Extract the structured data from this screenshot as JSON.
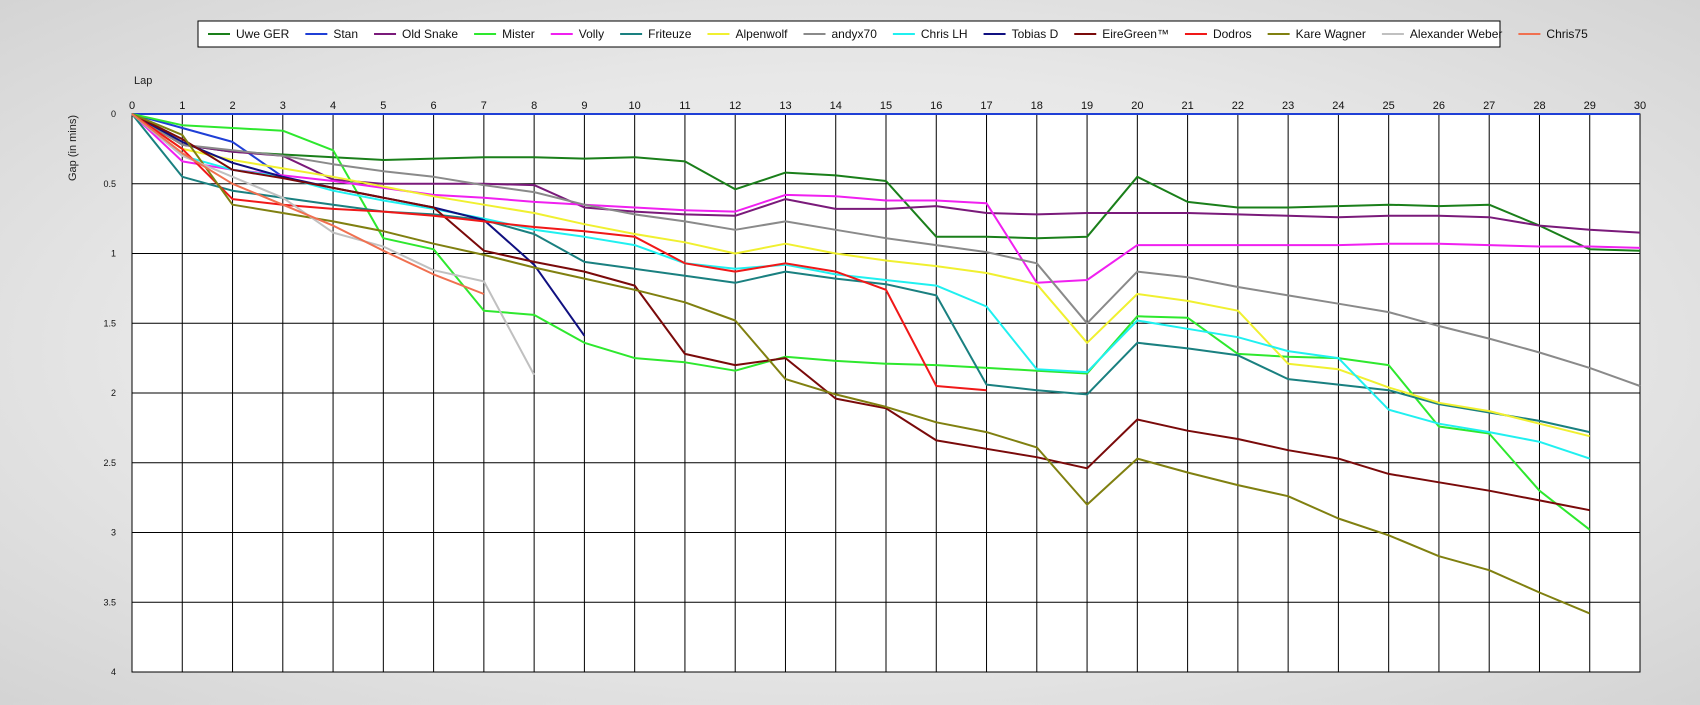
{
  "chart_data": {
    "type": "line",
    "xlabel": "Lap",
    "ylabel": "Gap (in mins)",
    "xlim": [
      0,
      30
    ],
    "ylim": [
      0,
      4
    ],
    "y_inverted": true,
    "grid": true,
    "legend_position": "top",
    "x_ticks": [
      "0",
      "1",
      "2",
      "3",
      "4",
      "5",
      "6",
      "7",
      "8",
      "9",
      "10",
      "11",
      "12",
      "13",
      "14",
      "15",
      "16",
      "17",
      "18",
      "19",
      "20",
      "21",
      "22",
      "23",
      "24",
      "25",
      "26",
      "27",
      "28",
      "29",
      "30"
    ],
    "y_ticks": [
      "0",
      "0.5",
      "1",
      "1.5",
      "2",
      "2.5",
      "3",
      "3.5",
      "4"
    ],
    "series": [
      {
        "name": "Uwe GER",
        "color": "#1a7f1a",
        "x": [
          0,
          1,
          2,
          3,
          4,
          5,
          6,
          7,
          8,
          9,
          10,
          11,
          12,
          13,
          14,
          15,
          16,
          17,
          18,
          19,
          20,
          21,
          22,
          23,
          24,
          25,
          26,
          27,
          28,
          29,
          30
        ],
        "values": [
          0,
          0.22,
          0.27,
          0.29,
          0.31,
          0.33,
          0.32,
          0.31,
          0.31,
          0.32,
          0.31,
          0.34,
          0.54,
          0.42,
          0.44,
          0.48,
          0.88,
          0.88,
          0.89,
          0.88,
          0.45,
          0.63,
          0.67,
          0.67,
          0.66,
          0.65,
          0.66,
          0.65,
          0.8,
          0.97,
          0.98
        ]
      },
      {
        "name": "Stan",
        "color": "#1f3fd6",
        "x": [
          0,
          1,
          2,
          3
        ],
        "values": [
          0,
          0.1,
          0.2,
          0.45
        ]
      },
      {
        "name": "Old Snake",
        "color": "#7a1a7a",
        "x": [
          0,
          1,
          2,
          3,
          4,
          5,
          6,
          7,
          8,
          9,
          10,
          11,
          12,
          13,
          14,
          15,
          16,
          17,
          18,
          19,
          20,
          21,
          22,
          23,
          24,
          25,
          26,
          27,
          28,
          29,
          30
        ],
        "values": [
          0,
          0.22,
          0.27,
          0.3,
          0.47,
          0.5,
          0.5,
          0.5,
          0.51,
          0.67,
          0.7,
          0.72,
          0.73,
          0.61,
          0.68,
          0.68,
          0.66,
          0.71,
          0.72,
          0.71,
          0.71,
          0.71,
          0.72,
          0.73,
          0.74,
          0.73,
          0.73,
          0.74,
          0.8,
          0.83,
          0.85
        ]
      },
      {
        "name": "Mister",
        "color": "#2ee82e",
        "x": [
          0,
          1,
          2,
          3,
          4,
          5,
          6,
          7,
          8,
          9,
          10,
          11,
          12,
          13,
          14,
          15,
          16,
          17,
          18,
          19,
          20,
          21,
          22,
          23,
          24,
          25,
          26,
          27,
          28,
          29
        ],
        "values": [
          0,
          0.08,
          0.1,
          0.12,
          0.26,
          0.89,
          0.97,
          1.41,
          1.44,
          1.64,
          1.75,
          1.78,
          1.84,
          1.74,
          1.77,
          1.79,
          1.8,
          1.82,
          1.84,
          1.86,
          1.45,
          1.46,
          1.72,
          1.74,
          1.75,
          1.8,
          2.24,
          2.29,
          2.7,
          2.98
        ]
      },
      {
        "name": "Volly",
        "color": "#f020f0",
        "x": [
          0,
          1,
          2,
          3,
          4,
          5,
          6,
          7,
          8,
          9,
          10,
          11,
          12,
          13,
          14,
          15,
          16,
          17,
          18,
          19,
          20,
          21,
          22,
          23,
          24,
          25,
          26,
          27,
          28,
          29,
          30
        ],
        "values": [
          0,
          0.34,
          0.4,
          0.44,
          0.48,
          0.53,
          0.58,
          0.6,
          0.63,
          0.65,
          0.67,
          0.69,
          0.7,
          0.58,
          0.59,
          0.62,
          0.62,
          0.64,
          1.21,
          1.19,
          0.94,
          0.94,
          0.94,
          0.94,
          0.94,
          0.93,
          0.93,
          0.94,
          0.95,
          0.95,
          0.96
        ]
      },
      {
        "name": "Friteuze",
        "color": "#1a8080",
        "x": [
          0,
          1,
          2,
          3,
          4,
          5,
          6,
          7,
          8,
          9,
          10,
          11,
          12,
          13,
          14,
          15,
          16,
          17,
          18,
          19,
          20,
          21,
          22,
          23,
          24,
          25,
          26,
          27,
          28,
          29
        ],
        "values": [
          0,
          0.45,
          0.55,
          0.6,
          0.65,
          0.7,
          0.72,
          0.76,
          0.86,
          1.06,
          1.11,
          1.16,
          1.21,
          1.13,
          1.18,
          1.22,
          1.3,
          1.94,
          1.98,
          2.01,
          1.64,
          1.68,
          1.73,
          1.9,
          1.94,
          1.98,
          2.08,
          2.14,
          2.2,
          2.28
        ]
      },
      {
        "name": "Alpenwolf",
        "color": "#f0f030",
        "x": [
          0,
          1,
          2,
          3,
          4,
          5,
          6,
          7,
          8,
          9,
          10,
          11,
          12,
          13,
          14,
          15,
          16,
          17,
          18,
          19,
          20,
          21,
          22,
          23,
          24,
          25,
          26,
          27,
          28,
          29
        ],
        "values": [
          0,
          0.25,
          0.33,
          0.39,
          0.45,
          0.52,
          0.59,
          0.65,
          0.71,
          0.79,
          0.86,
          0.92,
          1.0,
          0.93,
          1.0,
          1.05,
          1.09,
          1.14,
          1.22,
          1.64,
          1.29,
          1.34,
          1.41,
          1.79,
          1.83,
          1.96,
          2.07,
          2.13,
          2.22,
          2.31
        ]
      },
      {
        "name": "andyx70",
        "color": "#8a8a8a",
        "x": [
          0,
          1,
          2,
          3,
          4,
          5,
          6,
          7,
          8,
          9,
          10,
          11,
          12,
          13,
          14,
          15,
          16,
          17,
          18,
          19,
          20,
          21,
          22,
          23,
          24,
          25,
          26,
          27,
          28,
          29,
          30
        ],
        "values": [
          0,
          0.22,
          0.26,
          0.3,
          0.36,
          0.41,
          0.45,
          0.51,
          0.56,
          0.65,
          0.72,
          0.77,
          0.83,
          0.77,
          0.83,
          0.89,
          0.94,
          0.99,
          1.07,
          1.5,
          1.13,
          1.17,
          1.24,
          1.3,
          1.36,
          1.42,
          1.52,
          1.61,
          1.71,
          1.82,
          1.95
        ]
      },
      {
        "name": "Chris LH",
        "color": "#20f0f0",
        "x": [
          0,
          1,
          2,
          3,
          4,
          5,
          6,
          7,
          8,
          9,
          10,
          11,
          12,
          13,
          14,
          15,
          16,
          17,
          18,
          19,
          20,
          21,
          22,
          23,
          24,
          25,
          26,
          27,
          28,
          29
        ],
        "values": [
          0,
          0.3,
          0.4,
          0.45,
          0.55,
          0.62,
          0.68,
          0.75,
          0.83,
          0.88,
          0.94,
          1.07,
          1.11,
          1.08,
          1.15,
          1.19,
          1.23,
          1.38,
          1.83,
          1.85,
          1.48,
          1.54,
          1.6,
          1.7,
          1.75,
          2.12,
          2.22,
          2.28,
          2.35,
          2.47
        ]
      },
      {
        "name": "Tobias D",
        "color": "#101080",
        "x": [
          0,
          1,
          2,
          3,
          4,
          5,
          6,
          7,
          8,
          9
        ],
        "values": [
          0,
          0.2,
          0.35,
          0.45,
          0.53,
          0.6,
          0.67,
          0.76,
          1.08,
          1.59
        ]
      },
      {
        "name": "EireGreen™",
        "color": "#7a0a0a",
        "x": [
          0,
          1,
          2,
          3,
          4,
          5,
          6,
          7,
          8,
          9,
          10,
          11,
          12,
          13,
          14,
          15,
          16,
          17,
          18,
          19,
          20,
          21,
          22,
          23,
          24,
          25,
          26,
          27,
          28,
          29
        ],
        "values": [
          0,
          0.18,
          0.4,
          0.46,
          0.53,
          0.6,
          0.67,
          0.98,
          1.06,
          1.13,
          1.23,
          1.72,
          1.8,
          1.75,
          2.04,
          2.11,
          2.34,
          2.4,
          2.46,
          2.54,
          2.19,
          2.27,
          2.33,
          2.41,
          2.47,
          2.58,
          2.64,
          2.7,
          2.77,
          2.84
        ]
      },
      {
        "name": "Dodros",
        "color": "#f01818",
        "x": [
          0,
          1,
          2,
          3,
          4,
          5,
          6,
          7,
          8,
          9,
          10,
          11,
          12,
          13,
          14,
          15,
          16,
          17
        ],
        "values": [
          0,
          0.25,
          0.61,
          0.65,
          0.68,
          0.7,
          0.73,
          0.77,
          0.81,
          0.84,
          0.88,
          1.07,
          1.13,
          1.07,
          1.13,
          1.26,
          1.95,
          1.98
        ]
      },
      {
        "name": "Kare Wagner",
        "color": "#808010",
        "x": [
          0,
          1,
          2,
          3,
          4,
          5,
          6,
          7,
          8,
          9,
          10,
          11,
          12,
          13,
          14,
          15,
          16,
          17,
          18,
          19,
          20,
          21,
          22,
          23,
          24,
          25,
          26,
          27,
          28,
          29
        ],
        "values": [
          0,
          0.15,
          0.65,
          0.71,
          0.77,
          0.84,
          0.93,
          1.01,
          1.1,
          1.18,
          1.26,
          1.35,
          1.48,
          1.9,
          2.01,
          2.1,
          2.21,
          2.28,
          2.39,
          2.8,
          2.47,
          2.57,
          2.66,
          2.74,
          2.9,
          3.02,
          3.17,
          3.27,
          3.43,
          3.58
        ]
      },
      {
        "name": "Alexander Weber",
        "color": "#c0c0c0",
        "x": [
          0,
          1,
          2,
          3,
          4,
          5,
          6,
          7,
          8
        ],
        "values": [
          0,
          0.3,
          0.45,
          0.6,
          0.85,
          0.95,
          1.12,
          1.2,
          1.87
        ]
      },
      {
        "name": "Chris75",
        "color": "#f07050",
        "x": [
          0,
          1,
          2,
          3,
          4,
          5,
          6,
          7
        ],
        "values": [
          0,
          0.28,
          0.5,
          0.65,
          0.8,
          0.98,
          1.15,
          1.29
        ]
      }
    ]
  }
}
